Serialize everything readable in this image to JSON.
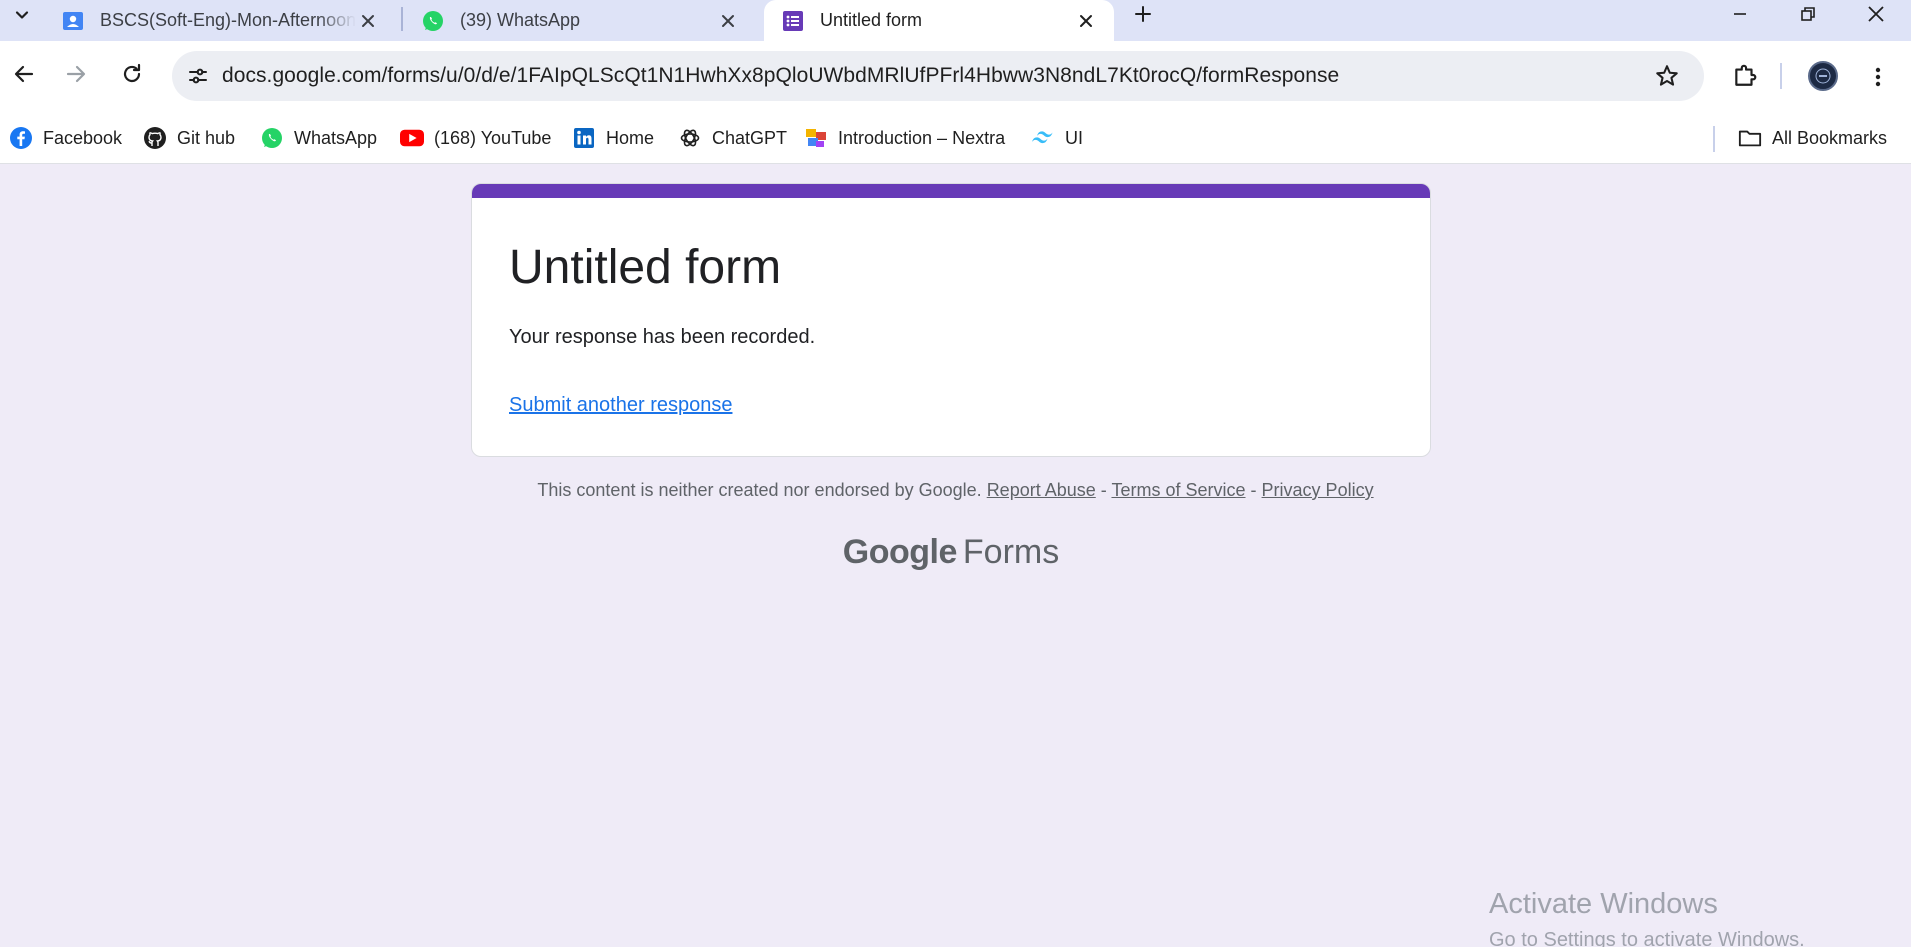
{
  "tabs": [
    {
      "title": "BSCS(Soft-Eng)-Mon-Afternoon",
      "icon": "classroom-icon",
      "active": false
    },
    {
      "title": "(39) WhatsApp",
      "icon": "whatsapp-icon",
      "active": false
    },
    {
      "title": "Untitled form",
      "icon": "google-forms-icon",
      "active": true
    }
  ],
  "address_bar": {
    "url": "docs.google.com/forms/u/0/d/e/1FAIpQLScQt1N1HwhXx8pQloUWbdMRlUfPFrl4Hbww3N8ndL7Kt0rocQ/formResponse"
  },
  "bookmarks": [
    {
      "label": "Facebook",
      "icon": "facebook-icon"
    },
    {
      "label": "Git hub",
      "icon": "github-icon"
    },
    {
      "label": "WhatsApp",
      "icon": "whatsapp-icon"
    },
    {
      "label": "(168) YouTube",
      "icon": "youtube-icon"
    },
    {
      "label": "Home",
      "icon": "linkedin-icon"
    },
    {
      "label": "ChatGPT",
      "icon": "chatgpt-icon"
    },
    {
      "label": "Introduction – Nextra",
      "icon": "nextra-icon"
    },
    {
      "label": "UI",
      "icon": "tailwind-icon"
    }
  ],
  "all_bookmarks_label": "All Bookmarks",
  "form": {
    "title": "Untitled form",
    "message": "Your response has been recorded.",
    "another_link": "Submit another response",
    "accent_color": "#673ab7"
  },
  "footer": {
    "disclaimer": "This content is neither created nor endorsed by Google.",
    "report_abuse": "Report Abuse",
    "terms": "Terms of Service",
    "privacy": "Privacy Policy",
    "sep": "-"
  },
  "branding": {
    "google": "Google",
    "forms": "Forms"
  },
  "watermark": {
    "line1": "Activate Windows",
    "line2": "Go to Settings to activate Windows."
  }
}
